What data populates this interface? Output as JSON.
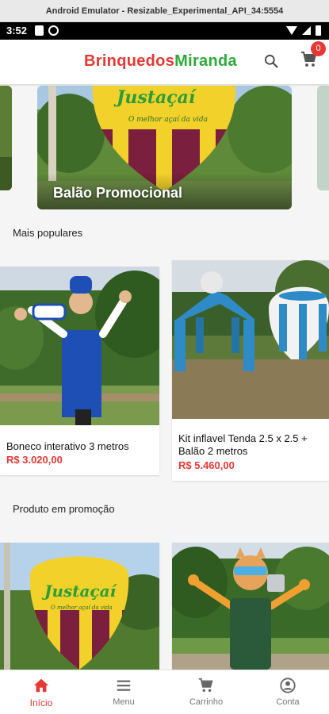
{
  "emulator": {
    "title": "Android Emulator - Resizable_Experimental_API_34:5554"
  },
  "status_bar": {
    "time": "3:52"
  },
  "app_bar": {
    "brand_part1": "Brinquedos",
    "brand_part2": "Miranda",
    "cart_count": "0"
  },
  "banner": {
    "title": "Balão Promocional",
    "lettering": "Justaçaí",
    "tagline": "O melhor açaí da vida"
  },
  "sections": {
    "popular": "Mais populares",
    "promo": "Produto em promoção"
  },
  "popular_products": [
    {
      "name": "Boneco interativo 3 metros",
      "price": "R$ 3.020,00"
    },
    {
      "name": "Kit inflavel Tenda 2.5 x 2.5 + Balão 2 metros",
      "price": "R$ 5.460,00"
    }
  ],
  "promo_images": {
    "balloon_lettering": "Justaçaí",
    "balloon_tagline": "O melhor açaí da vida"
  },
  "bottom_nav": [
    {
      "label": "Início",
      "icon": "home-icon",
      "active": true
    },
    {
      "label": "Menu",
      "icon": "menu-icon",
      "active": false
    },
    {
      "label": "Carrinho",
      "icon": "cart-icon",
      "active": false
    },
    {
      "label": "Conta",
      "icon": "account-icon",
      "active": false
    }
  ],
  "colors": {
    "accent": "#e53935",
    "brand_green": "#2eaa3a"
  }
}
